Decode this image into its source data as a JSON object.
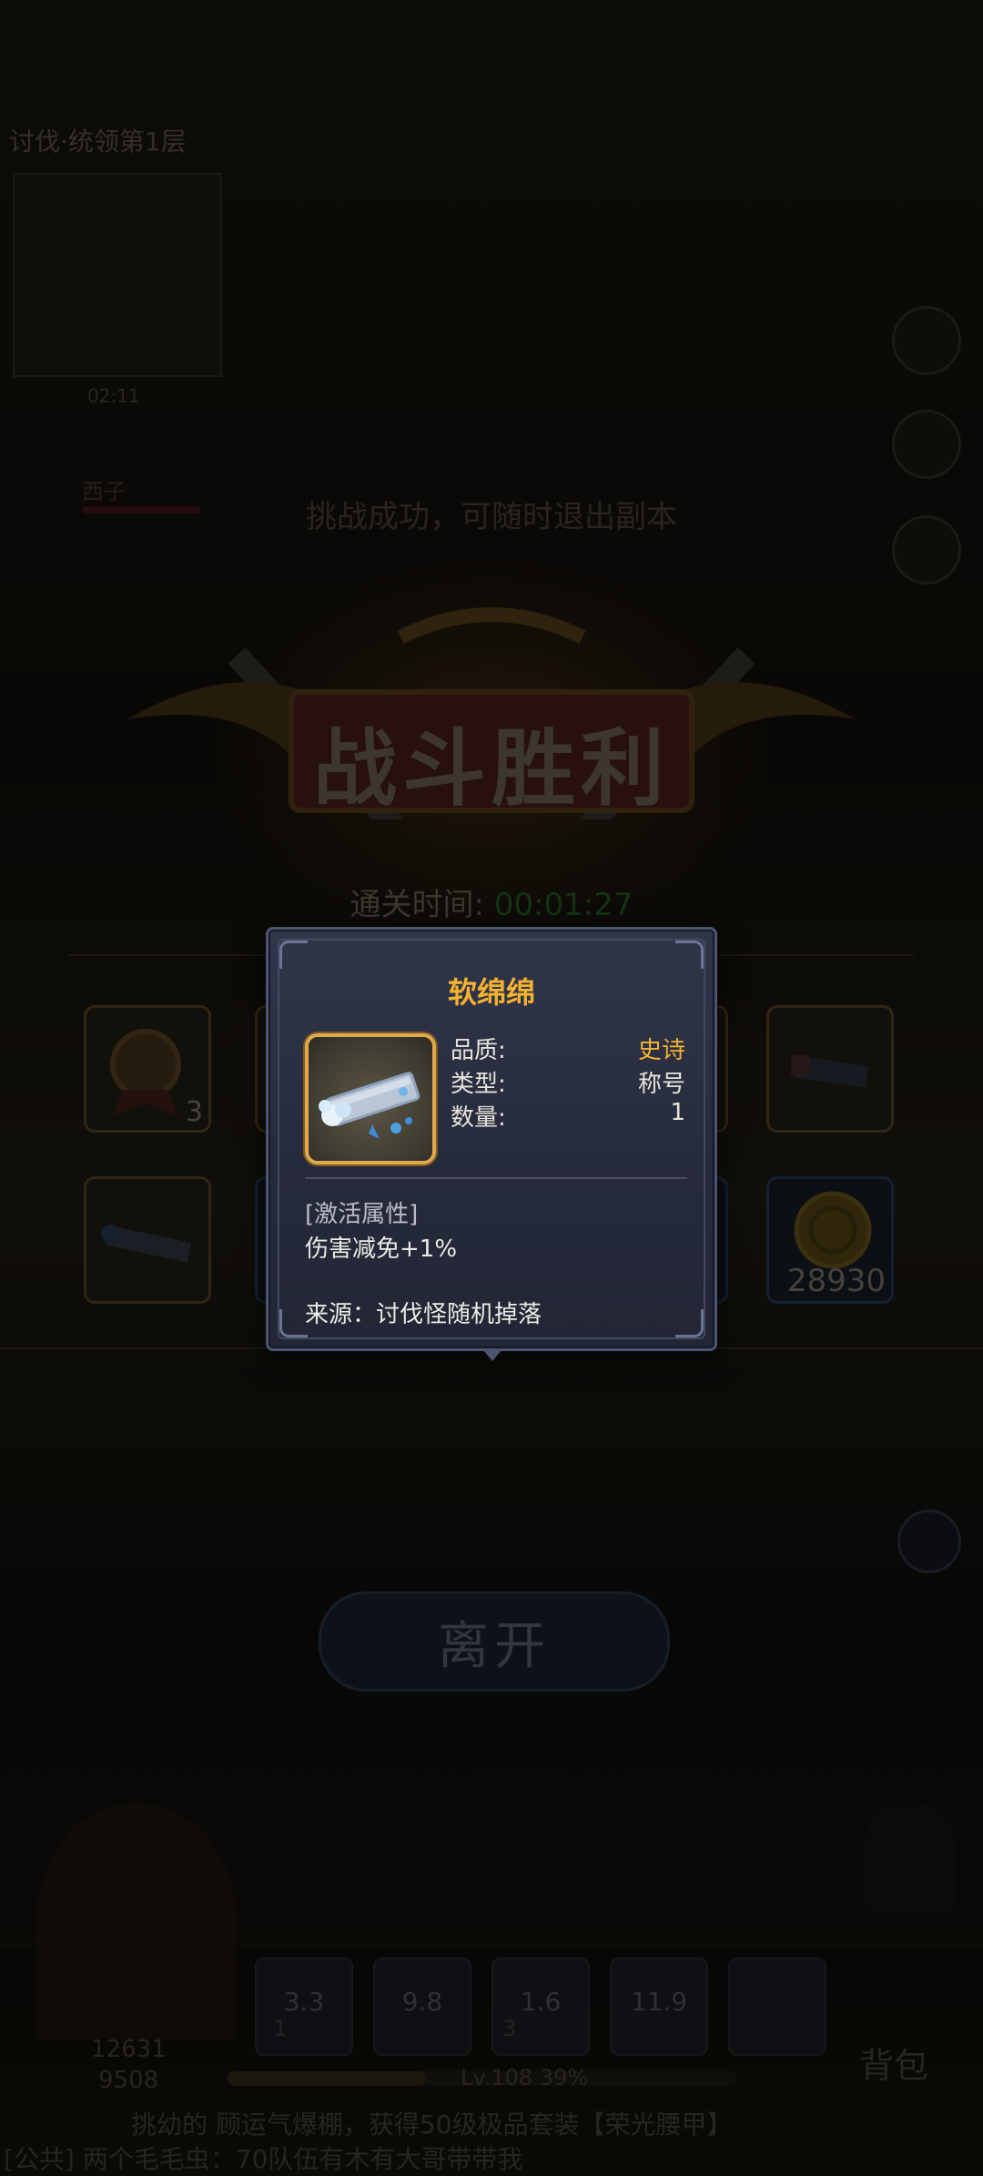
{
  "scene": {
    "top_title": "讨伐·统领第1层",
    "minimap_timer": "02:11",
    "player_name": "西子",
    "hint": "挑战成功，可随时退出副本",
    "victory": "战斗胜利",
    "clear_time_label": "通关时间:",
    "clear_time_value": "00:01:27",
    "rewards_row1": [
      {
        "count": "3"
      },
      {
        "count": ""
      },
      {
        "count": ""
      },
      {
        "count": ""
      }
    ],
    "rewards_row2": [
      {
        "count": ""
      },
      {
        "count": ""
      },
      {
        "count": ""
      },
      {
        "count": "28930"
      }
    ],
    "leave_button": "离开",
    "skills": [
      "3.3",
      "9.8",
      "1.6",
      "11.9"
    ],
    "skill_badges": [
      "1",
      "3"
    ],
    "power": "12631",
    "hp": "9508",
    "level": "Lv.108",
    "xp_percent": "39%",
    "bag_label": "背包",
    "ticker1": "挑幼的 顾运气爆棚，获得50级极品套装【荣光腰甲】",
    "ticker2": "[公共] 两个毛毛虫：70队伍有木有大哥带带我"
  },
  "popup": {
    "title": "软绵绵",
    "quality_label": "品质:",
    "quality_value": "史诗",
    "type_label": "类型:",
    "type_value": "称号",
    "count_label": "数量:",
    "count_value": "1",
    "attr_header": "[激活属性]",
    "attr_value": "伤害减免+1%",
    "source": "来源：讨伐怪随机掉落"
  },
  "colors": {
    "accent_gold": "#f4b232",
    "popup_bg": "#2a3042",
    "popup_border": "#4b5470"
  }
}
